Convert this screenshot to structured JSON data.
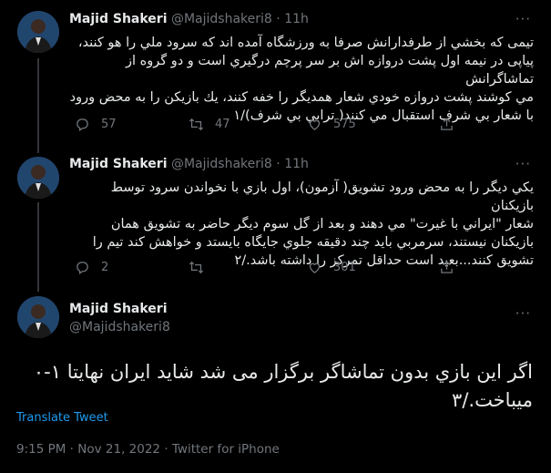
{
  "tweets": [
    {
      "name": "Majid Shakeri",
      "handle": "@Majidshakeri8",
      "separator": "·",
      "time": "11h",
      "more": "···",
      "lines": [
        "تیمی که بخشي از طرفدارانش صرفا به ورزشگاه آمده اند که سرود ملي را هو کنند،",
        "پیاپی در نیمه اول پشت دروازه اش بر سر پرچم درگیري است و دو گروه از تماشاگرانش",
        "مي کوشند پشت دروازه خودي شعار همدیگر را خفه کنند، یك بازیکن را به محض ورود",
        "با شعار بي شرف استقبال مي کنند( ترابي بي شرف)/۱"
      ],
      "replies": "57",
      "retweets": "47",
      "likes": "575"
    },
    {
      "name": "Majid Shakeri",
      "handle": "@Majidshakeri8",
      "separator": "·",
      "time": "11h",
      "more": "···",
      "lines": [
        "یکي دیگر را به محض ورود تشویق( آزمون)، اول بازي با نخواندن سرود توسط بازیکنان",
        "شعار \"ایراني با غیرت\" مي دهند و بعد از گل سوم دیگر حاضر به تشویق همان",
        "بازیکنان نیستند، سرمربي باید چند دقیقه جلوي جایگاه بایستد و خواهش کند تیم را",
        "تشویق کنند...بعید است حداقل تمرکز را داشته باشد./۲"
      ],
      "replies": "2",
      "retweets": "",
      "likes": "301"
    }
  ],
  "main": {
    "name": "Majid Shakeri",
    "handle": "@Majidshakeri8",
    "more": "···",
    "lines": [
      "اگر این بازي بدون تماشاگر برگزار مى شد شاید ایران نهایتا ۱-۰",
      "میباخت./۳"
    ],
    "translate": "Translate Tweet",
    "meta": "9:15 PM · Nov 21, 2022 · Twitter for iPhone"
  },
  "colors": {
    "accent": "#1d9bf0",
    "muted": "#71767b",
    "text": "#e7e9ea",
    "bg": "#000000"
  }
}
